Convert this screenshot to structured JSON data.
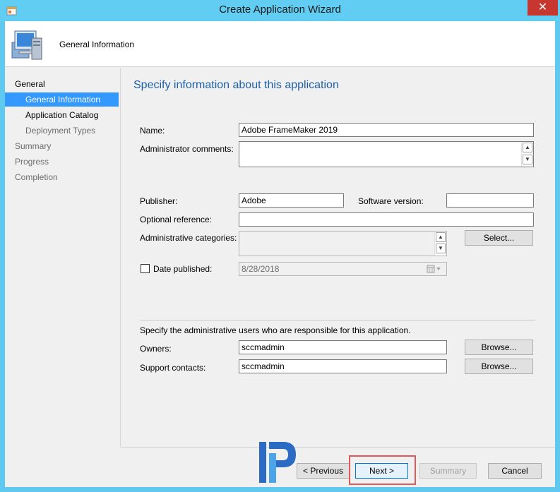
{
  "window": {
    "title": "Create Application Wizard",
    "close_glyph": "✕",
    "icons": {
      "app": "wizard-app-icon",
      "close": "close-icon"
    }
  },
  "header": {
    "title": "General Information",
    "icon": "computer-icon"
  },
  "nav": {
    "items": [
      {
        "label": "General",
        "level": 1,
        "state": "normal"
      },
      {
        "label": "General Information",
        "level": 2,
        "state": "active"
      },
      {
        "label": "Application Catalog",
        "level": 2,
        "state": "normal"
      },
      {
        "label": "Deployment Types",
        "level": 2,
        "state": "dim"
      },
      {
        "label": "Summary",
        "level": 1,
        "state": "dim"
      },
      {
        "label": "Progress",
        "level": 1,
        "state": "dim"
      },
      {
        "label": "Completion",
        "level": 1,
        "state": "dim"
      }
    ]
  },
  "form": {
    "heading": "Specify information about this application",
    "name_label": "Name:",
    "name_value": "Adobe FrameMaker 2019",
    "admin_comments_label": "Administrator comments:",
    "admin_comments_value": "",
    "publisher_label": "Publisher:",
    "publisher_value": "Adobe",
    "software_version_label": "Software version:",
    "software_version_value": "",
    "optional_reference_label": "Optional reference:",
    "optional_reference_value": "",
    "admin_categories_label": "Administrative categories:",
    "select_button": "Select...",
    "date_published_label": "Date published:",
    "date_published_value": "8/28/2018",
    "admin_users_text": "Specify the administrative users who are responsible for this application.",
    "owners_label": "Owners:",
    "owners_value": "sccmadmin",
    "owners_browse": "Browse...",
    "support_contacts_label": "Support contacts:",
    "support_contacts_value": "sccmadmin",
    "support_browse": "Browse..."
  },
  "footer": {
    "previous": "< Previous",
    "next": "Next >",
    "summary": "Summary",
    "cancel": "Cancel"
  },
  "colors": {
    "titlebar": "#62cdf2",
    "accent": "#3399ff",
    "heading": "#1f5fa6",
    "close": "#c7372f",
    "highlight": "#e05a5a"
  }
}
